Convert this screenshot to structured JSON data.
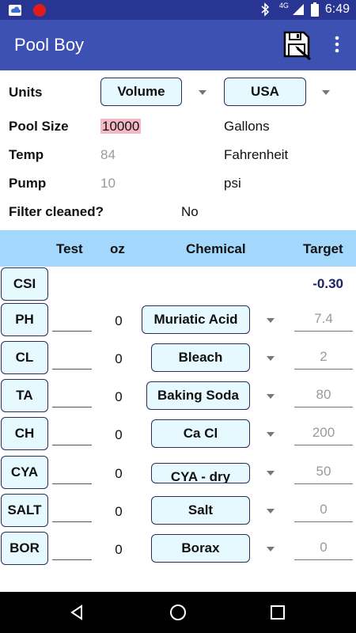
{
  "status_bar": {
    "time": "6:49",
    "network": "4G",
    "icons": [
      "cloud-notification-icon",
      "screen-record-icon",
      "bluetooth-icon",
      "signal-icon",
      "battery-icon"
    ]
  },
  "app_bar": {
    "title": "Pool Boy",
    "actions": [
      "save-settings-icon",
      "overflow-menu-icon"
    ]
  },
  "settings": {
    "units": {
      "label": "Units",
      "volume_option": "Volume",
      "system_option": "USA"
    },
    "pool_size": {
      "label": "Pool Size",
      "value": "10000",
      "unit": "Gallons"
    },
    "temp": {
      "label": "Temp",
      "placeholder": "84",
      "unit": "Fahrenheit"
    },
    "pump": {
      "label": "Pump",
      "placeholder": "10",
      "unit": "psi"
    },
    "filter": {
      "label": "Filter cleaned?",
      "value": "No"
    }
  },
  "table": {
    "headers": {
      "test": "Test",
      "oz": "oz",
      "chemical": "Chemical",
      "target": "Target"
    },
    "csi": {
      "label": "CSI",
      "value": "-0.30"
    },
    "rows": [
      {
        "test": "PH",
        "oz": "0",
        "chemical": "Muriatic Acid",
        "target": "7.4"
      },
      {
        "test": "CL",
        "oz": "0",
        "chemical": "Bleach",
        "target": "2"
      },
      {
        "test": "TA",
        "oz": "0",
        "chemical": "Baking Soda",
        "target": "80"
      },
      {
        "test": "CH",
        "oz": "0",
        "chemical": "Ca Cl",
        "target": "200"
      },
      {
        "test": "CYA",
        "oz": "0",
        "chemical": "CYA - dry",
        "target": "50"
      },
      {
        "test": "SALT",
        "oz": "0",
        "chemical": "Salt",
        "target": "0"
      },
      {
        "test": "BOR",
        "oz": "0",
        "chemical": "Borax",
        "target": "0"
      }
    ]
  },
  "nav_bar": {
    "buttons": [
      "back-icon",
      "home-icon",
      "recents-icon"
    ]
  },
  "colors": {
    "status_bar": "#293592",
    "app_bar": "#3d51b3",
    "table_header": "#a3d8fc",
    "button_fill": "#e6f9ff",
    "highlight": "#f4b8c6"
  }
}
